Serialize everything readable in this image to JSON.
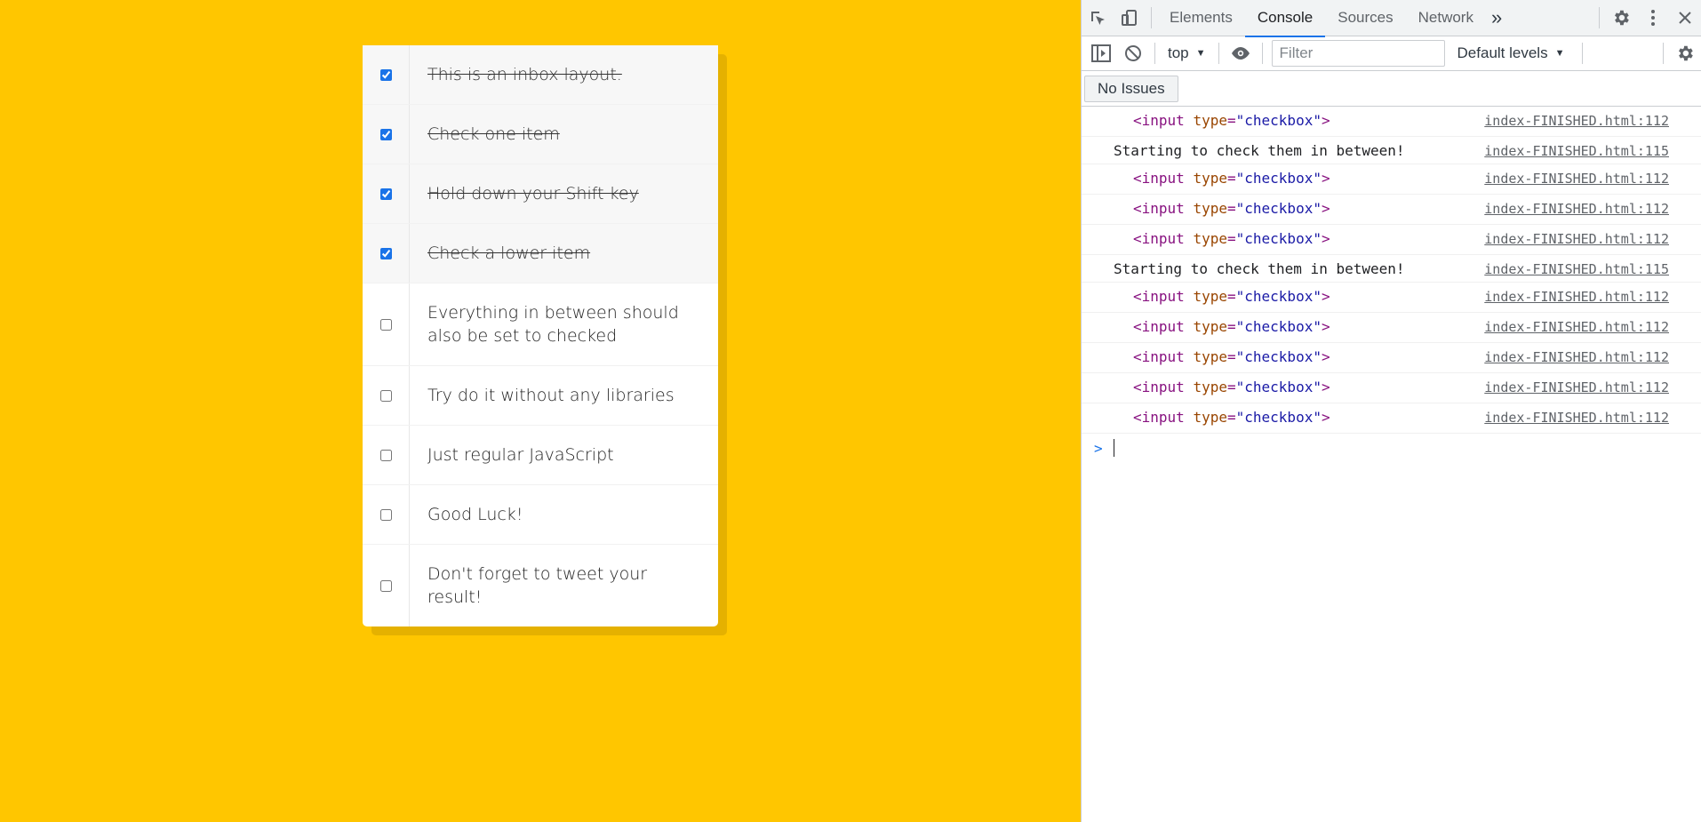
{
  "checklist": {
    "items": [
      {
        "text": "This is an inbox layout.",
        "checked": true
      },
      {
        "text": "Check one item",
        "checked": true
      },
      {
        "text": "Hold down your Shift key",
        "checked": true
      },
      {
        "text": "Check a lower item",
        "checked": true
      },
      {
        "text": "Everything in between should also be set to checked",
        "checked": false
      },
      {
        "text": "Try do it without any libraries",
        "checked": false
      },
      {
        "text": "Just regular JavaScript",
        "checked": false
      },
      {
        "text": "Good Luck!",
        "checked": false
      },
      {
        "text": "Don't forget to tweet your result!",
        "checked": false
      }
    ]
  },
  "devtools": {
    "tabs": [
      "Elements",
      "Console",
      "Sources",
      "Network"
    ],
    "active_tab": "Console",
    "overflow_label": "»",
    "toolbar": {
      "context": "top",
      "filter_placeholder": "Filter",
      "levels": "Default levels"
    },
    "issues_label": "No Issues",
    "console": {
      "entries": [
        {
          "kind": "element",
          "tag": "input",
          "attr": "type",
          "value": "checkbox",
          "source": "index-FINISHED.html:112"
        },
        {
          "kind": "text",
          "text": "Starting to check them in between!",
          "source": "index-FINISHED.html:115"
        },
        {
          "kind": "element",
          "tag": "input",
          "attr": "type",
          "value": "checkbox",
          "source": "index-FINISHED.html:112"
        },
        {
          "kind": "element",
          "tag": "input",
          "attr": "type",
          "value": "checkbox",
          "source": "index-FINISHED.html:112"
        },
        {
          "kind": "element",
          "tag": "input",
          "attr": "type",
          "value": "checkbox",
          "source": "index-FINISHED.html:112"
        },
        {
          "kind": "text",
          "text": "Starting to check them in between!",
          "source": "index-FINISHED.html:115"
        },
        {
          "kind": "element",
          "tag": "input",
          "attr": "type",
          "value": "checkbox",
          "source": "index-FINISHED.html:112"
        },
        {
          "kind": "element",
          "tag": "input",
          "attr": "type",
          "value": "checkbox",
          "source": "index-FINISHED.html:112"
        },
        {
          "kind": "element",
          "tag": "input",
          "attr": "type",
          "value": "checkbox",
          "source": "index-FINISHED.html:112"
        },
        {
          "kind": "element",
          "tag": "input",
          "attr": "type",
          "value": "checkbox",
          "source": "index-FINISHED.html:112"
        },
        {
          "kind": "element",
          "tag": "input",
          "attr": "type",
          "value": "checkbox",
          "source": "index-FINISHED.html:112"
        }
      ],
      "prompt_symbol": ">"
    }
  },
  "colors": {
    "page_background": "#ffc600",
    "accent": "#1a73e8"
  }
}
